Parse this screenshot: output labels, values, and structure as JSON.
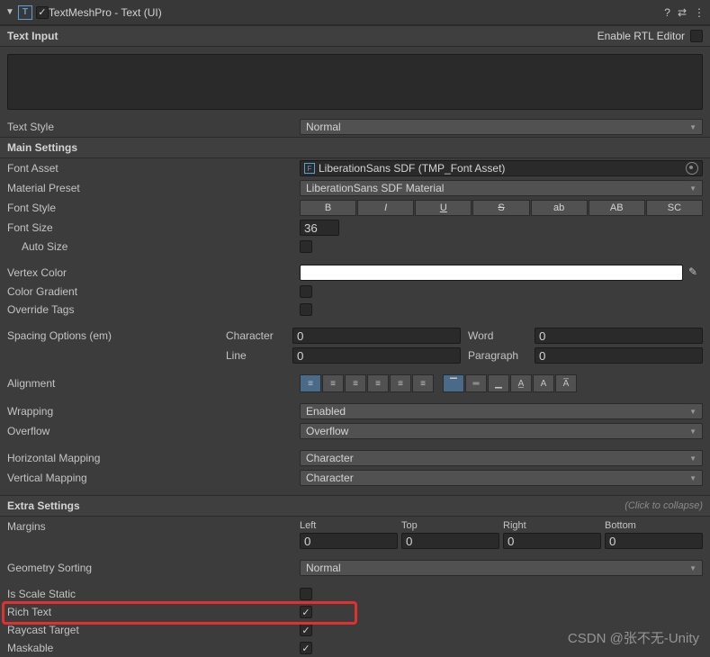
{
  "header": {
    "title": "TextMeshPro - Text (UI)",
    "enabled": true
  },
  "textInput": {
    "sectionLabel": "Text Input",
    "rtlLabel": "Enable RTL Editor",
    "rtlEnabled": false,
    "content": ""
  },
  "textStyle": {
    "label": "Text Style",
    "value": "Normal"
  },
  "mainSettings": {
    "sectionLabel": "Main Settings",
    "fontAsset": {
      "label": "Font Asset",
      "value": "LiberationSans SDF (TMP_Font Asset)"
    },
    "materialPreset": {
      "label": "Material Preset",
      "value": "LiberationSans SDF Material"
    },
    "fontStyle": {
      "label": "Font Style",
      "buttons": [
        "B",
        "I",
        "U",
        "S",
        "ab",
        "AB",
        "SC"
      ]
    },
    "fontSize": {
      "label": "Font Size",
      "value": "36"
    },
    "autoSize": {
      "label": "Auto Size",
      "checked": false
    },
    "vertexColor": {
      "label": "Vertex Color",
      "hex": "#ffffff"
    },
    "colorGradient": {
      "label": "Color Gradient",
      "checked": false
    },
    "overrideTags": {
      "label": "Override Tags",
      "checked": false
    },
    "spacing": {
      "label": "Spacing Options (em)",
      "character": {
        "label": "Character",
        "value": "0"
      },
      "word": {
        "label": "Word",
        "value": "0"
      },
      "line": {
        "label": "Line",
        "value": "0"
      },
      "paragraph": {
        "label": "Paragraph",
        "value": "0"
      }
    },
    "alignment": {
      "label": "Alignment"
    },
    "wrapping": {
      "label": "Wrapping",
      "value": "Enabled"
    },
    "overflow": {
      "label": "Overflow",
      "value": "Overflow"
    },
    "horizontalMapping": {
      "label": "Horizontal Mapping",
      "value": "Character"
    },
    "verticalMapping": {
      "label": "Vertical Mapping",
      "value": "Character"
    }
  },
  "extraSettings": {
    "sectionLabel": "Extra Settings",
    "collapseHint": "(Click to collapse)",
    "margins": {
      "label": "Margins",
      "left": {
        "label": "Left",
        "value": "0"
      },
      "top": {
        "label": "Top",
        "value": "0"
      },
      "right": {
        "label": "Right",
        "value": "0"
      },
      "bottom": {
        "label": "Bottom",
        "value": "0"
      }
    },
    "geometrySorting": {
      "label": "Geometry Sorting",
      "value": "Normal"
    },
    "isScaleStatic": {
      "label": "Is Scale Static",
      "checked": false
    },
    "richText": {
      "label": "Rich Text",
      "checked": true
    },
    "raycastTarget": {
      "label": "Raycast Target",
      "checked": true
    },
    "maskable": {
      "label": "Maskable",
      "checked": true
    }
  },
  "watermark": "CSDN @张不无-Unity"
}
